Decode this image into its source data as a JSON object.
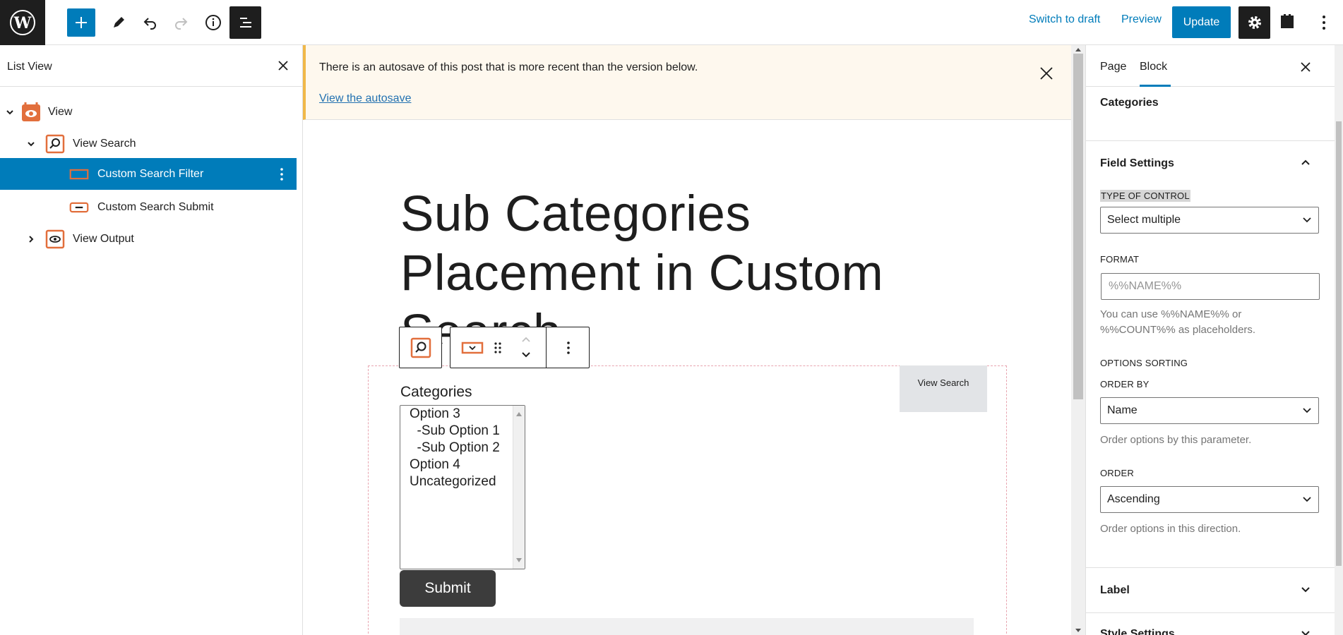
{
  "topbar": {
    "switch_to_draft": "Switch to draft",
    "preview": "Preview",
    "update": "Update"
  },
  "listview": {
    "title": "List View",
    "items": [
      {
        "label": "View",
        "level": 0,
        "expanded": true,
        "icon": "view-icon"
      },
      {
        "label": "View Search",
        "level": 1,
        "expanded": true,
        "icon": "search-block-icon"
      },
      {
        "label": "Custom Search Filter",
        "level": 2,
        "selected": true,
        "icon": "filter-block-icon"
      },
      {
        "label": "Custom Search Submit",
        "level": 2,
        "icon": "submit-block-icon"
      },
      {
        "label": "View Output",
        "level": 1,
        "expanded": false,
        "icon": "view-output-icon"
      }
    ]
  },
  "notice": {
    "text": "There is an autosave of this post that is more recent than the version below.",
    "link": "View the autosave"
  },
  "editor": {
    "title": "Sub Categories Placement in Custom Search",
    "view_search_tag": "View Search",
    "categories_label": "Categories",
    "options": [
      "Option 3",
      "  -Sub Option 1",
      "  -Sub Option 2",
      "Option 4",
      "Uncategorized"
    ],
    "submit": "Submit"
  },
  "settings": {
    "tabs": [
      "Page",
      "Block"
    ],
    "active_tab": "Block",
    "block_title": "Categories",
    "field_settings": {
      "title": "Field Settings",
      "type_of_control_label": "TYPE OF CONTROL",
      "type_of_control_value": "Select multiple",
      "format_label": "FORMAT",
      "format_placeholder": "%%NAME%%",
      "format_help": "You can use %%NAME%% or %%COUNT%% as placeholders.",
      "options_sorting_label": "OPTIONS SORTING",
      "order_by_label": "ORDER BY",
      "order_by_value": "Name",
      "order_by_help": "Order options by this parameter.",
      "order_label": "ORDER",
      "order_value": "Ascending",
      "order_help": "Order options in this direction."
    },
    "label_panel": "Label",
    "style_panel": "Style Settings"
  },
  "colors": {
    "accent": "#007cba",
    "dark": "#1e1e1e",
    "block_icon": "#e26f3c",
    "notice_bg": "#fef8ee",
    "notice_border": "#f0b849"
  }
}
